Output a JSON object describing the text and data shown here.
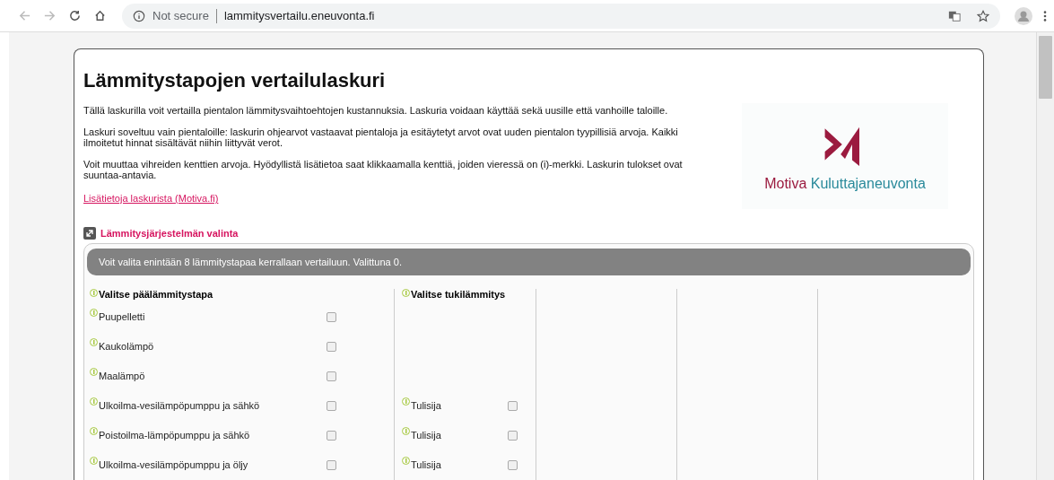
{
  "browser": {
    "security": "Not secure",
    "url": "lammitysvertailu.eneuvonta.fi"
  },
  "page": {
    "title": "Lämmitystapojen vertailulaskuri",
    "paragraphs": [
      "Tällä laskurilla voit vertailla pientalon lämmitysvaihtoehtojen kustannuksia. Laskuria voidaan käyttää sekä uusille että vanhoille taloille.",
      "Laskuri soveltuu vain pientaloille: laskurin ohjearvot vastaavat pientaloja ja esitäytetyt arvot ovat uuden pientalon tyypillisiä arvoja. Kaikki ilmoitetut hinnat sisältävät niihin liittyvät verot.",
      "Voit muuttaa vihreiden kenttien arvoja. Hyödyllistä lisätietoa saat klikkaamalla kenttiä, joiden vieressä on (i)-merkki. Laskurin tulokset ovat suuntaa-antavia."
    ],
    "link": "Lisätietoja laskurista (Motiva.fi)",
    "logo": {
      "brand": "Motiva",
      "sub": "Kuluttajaneuvonta"
    }
  },
  "section": {
    "title": "Lämmitysjärjestelmän valinta",
    "notice": "Voit valita enintään 8 lämmitystapaa kerrallaan vertailuun. Valittuna 0.",
    "main_heading": "Valitse päälämmitystapa",
    "support_heading": "Valitse tukilämmitys",
    "options": [
      {
        "label": "Puupelletti",
        "checked": false
      },
      {
        "label": "Kaukolämpö",
        "checked": false
      },
      {
        "label": "Maalämpö",
        "checked": false
      },
      {
        "label": "Ulkoilma-vesilämpöpumppu ja sähkö",
        "checked": false,
        "support": {
          "label": "Tulisija",
          "checked": false
        }
      },
      {
        "label": "Poistoilma-lämpöpumppu ja sähkö",
        "checked": false,
        "support": {
          "label": "Tulisija",
          "checked": false
        }
      },
      {
        "label": "Ulkoilma-vesilämpöpumppu ja öljy",
        "checked": false,
        "support": {
          "label": "Tulisija",
          "checked": false
        }
      }
    ]
  }
}
